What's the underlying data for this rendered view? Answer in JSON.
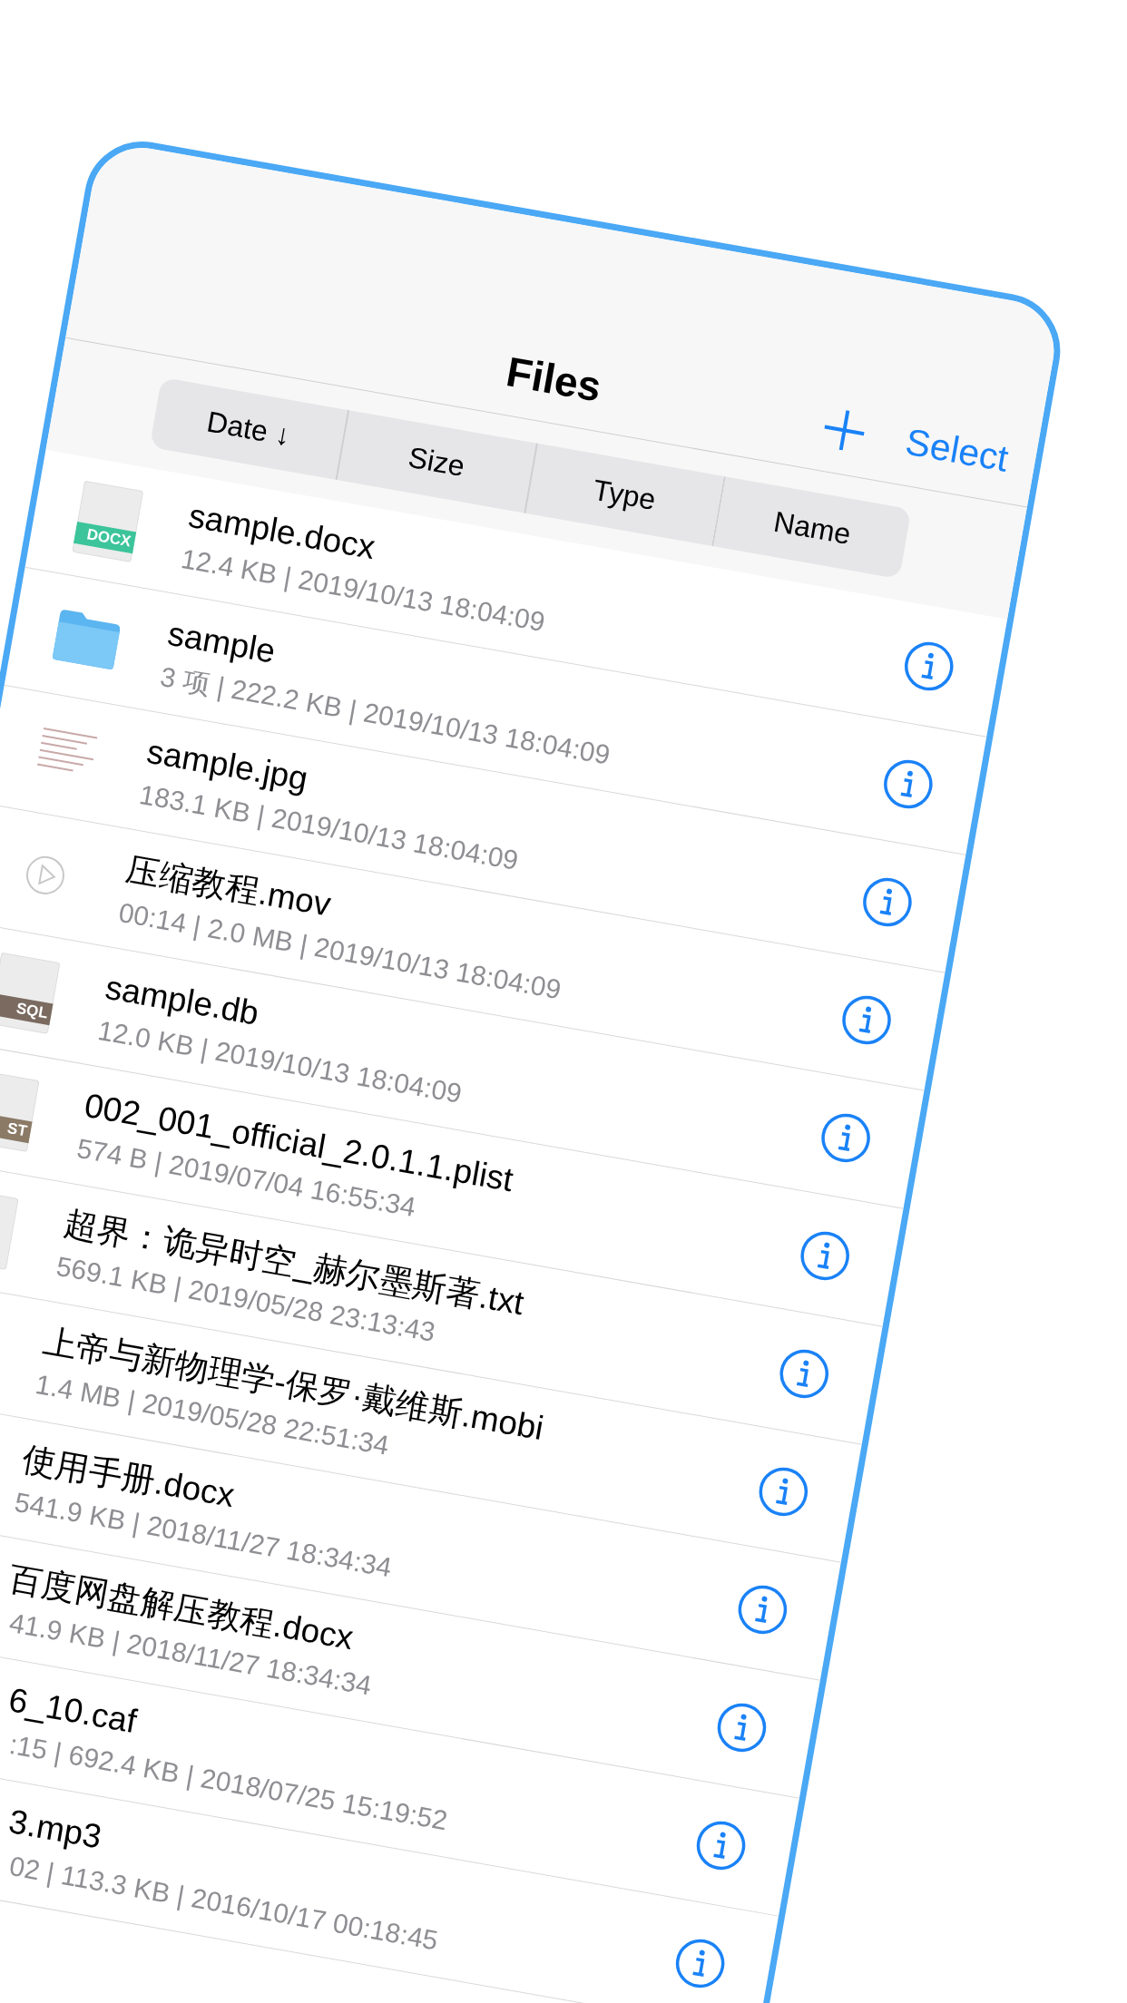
{
  "title": "Files",
  "select_button": "Select",
  "sort": [
    "Date ↓",
    "Size",
    "Type",
    "Name"
  ],
  "files": [
    {
      "name": "sample.docx",
      "meta": "12.4 KB | 2019/10/13 18:04:09",
      "icon": {
        "kind": "doc",
        "badge": "DOCX",
        "color": "#3cc49a"
      }
    },
    {
      "name": "sample",
      "meta": "3 项 | 222.2 KB | 2019/10/13 18:04:09",
      "icon": {
        "kind": "folder"
      }
    },
    {
      "name": "sample.jpg",
      "meta": "183.1 KB | 2019/10/13 18:04:09",
      "icon": {
        "kind": "image"
      }
    },
    {
      "name": "压缩教程.mov",
      "meta": "00:14 | 2.0 MB | 2019/10/13 18:04:09",
      "icon": {
        "kind": "video"
      }
    },
    {
      "name": "sample.db",
      "meta": "12.0 KB | 2019/10/13 18:04:09",
      "icon": {
        "kind": "doc",
        "badge": "SQL",
        "color": "#7a6a60"
      }
    },
    {
      "name": "002_001_official_2.0.1.1.plist",
      "meta": "574 B | 2019/07/04 16:55:34",
      "icon": {
        "kind": "doc",
        "badge": "ST",
        "color": "#8a7a66"
      }
    },
    {
      "name": "超界：诡异时空_赫尔墨斯著.txt",
      "meta": "569.1 KB | 2019/05/28 23:13:43",
      "icon": {
        "kind": "doc"
      }
    },
    {
      "name": "上帝与新物理学-保罗·戴维斯.mobi",
      "meta": "1.4 MB | 2019/05/28 22:51:34"
    },
    {
      "name": "使用手册.docx",
      "meta": "541.9 KB | 2018/11/27 18:34:34"
    },
    {
      "name": "百度网盘解压教程.docx",
      "meta": "41.9 KB | 2018/11/27 18:34:34"
    },
    {
      "name": "6_10.caf",
      "meta": ":15 | 692.4 KB | 2018/07/25 15:19:52"
    },
    {
      "name": "3.mp3",
      "meta": "02 | 113.3 KB | 2016/10/17 00:18:45"
    }
  ]
}
